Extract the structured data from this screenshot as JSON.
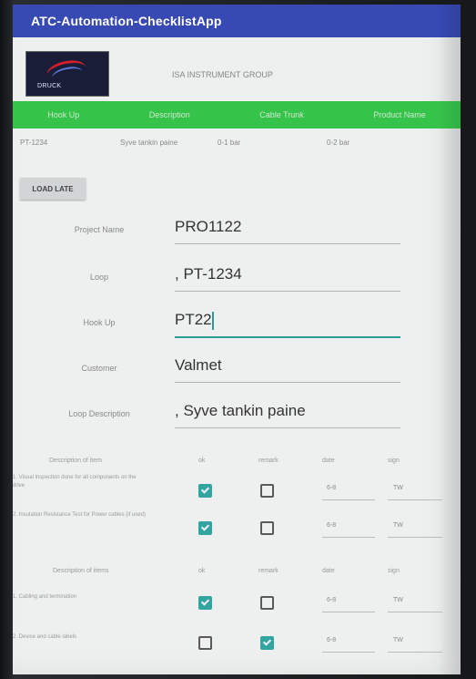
{
  "app_bar": {
    "title": "ATC-Automation-ChecklistApp"
  },
  "header": {
    "company": "ISA INSTRUMENT GROUP",
    "logo_text": "DRUCK"
  },
  "green_bar": {
    "items": [
      "Hook Up",
      "Description",
      "Cable Trunk",
      "Product Name"
    ]
  },
  "info": {
    "tag": "PT-1234",
    "desc": "Syve tankin paine",
    "low": "0-1 bar",
    "high": "0-2 bar"
  },
  "load_button": "LOAD LATE",
  "form": {
    "project_label": "Project Name",
    "project_value": "PRO1122",
    "loop_label": "Loop",
    "loop_value": ", PT-1234",
    "hookup_label": "Hook Up",
    "hookup_value": "PT22",
    "customer_label": "Customer",
    "customer_value": "Valmet",
    "loop_desc_label": "Loop Description",
    "loop_desc_value": ", Syve tankin paine"
  },
  "table1": {
    "headers": [
      "Description of item",
      "ok",
      "remark",
      "date",
      "sign"
    ],
    "rows": [
      {
        "desc": "1. Visual inspection done for all components on the drive",
        "ok": true,
        "remark": false,
        "date": "6-8",
        "sign": "TW"
      },
      {
        "desc": "2. Insulation Resistance Test for Power cables (if used)",
        "ok": true,
        "remark": false,
        "date": "6-8",
        "sign": "TW"
      }
    ]
  },
  "table2": {
    "headers": [
      "Description of items",
      "ok",
      "remark",
      "date",
      "sign"
    ],
    "rows": [
      {
        "desc": "1. Cabling and termination",
        "ok": true,
        "remark": false,
        "date": "6-8",
        "sign": "TW"
      },
      {
        "desc": "2. Device and cable labels",
        "ok": false,
        "remark": true,
        "date": "6-8",
        "sign": "TW"
      }
    ]
  }
}
